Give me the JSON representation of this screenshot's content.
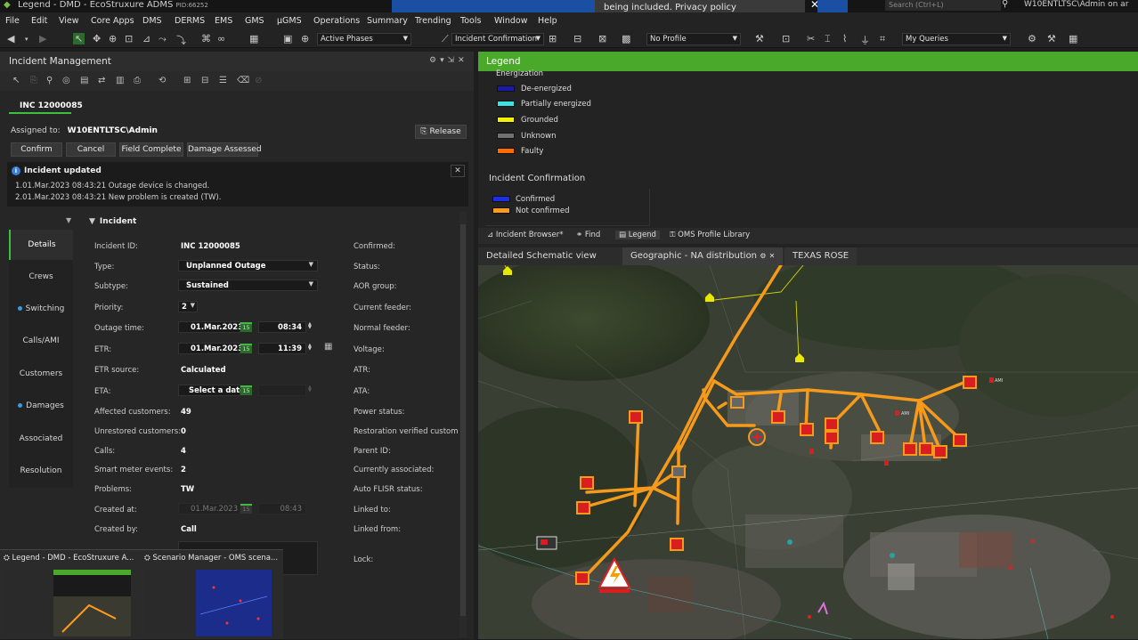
{
  "app": {
    "title": "Legend - DMD - EcoStruxure ADMS",
    "pid": "PID:66252",
    "toast_text": "being included. Privacy policy",
    "search_placeholder": "Search (Ctrl+L)",
    "user": "W10ENTLTSC\\Admin on ar"
  },
  "menu": [
    "File",
    "Edit",
    "View",
    "Core Apps",
    "DMS",
    "DERMS",
    "EMS",
    "GMS",
    "µGMS",
    "Operations",
    "Summary",
    "Trending",
    "Tools",
    "Window",
    "Help"
  ],
  "toolbar": {
    "phases": "Active Phases",
    "confirmation": "Incident Confirmation",
    "profile": "No Profile",
    "queries": "My Queries"
  },
  "incident_panel": {
    "title": "Incident Management",
    "tab": "INC 12000085",
    "assigned_label": "Assigned to:",
    "assigned_value": "W10ENTLTSC\\Admin",
    "release": "Release",
    "buttons": [
      "Confirm",
      "Cancel",
      "Field Complete",
      "Damage Assessed"
    ],
    "notification": {
      "title": "Incident updated",
      "lines": [
        "1.01.Mar.2023 08:43:21  Outage device is changed.",
        "2.01.Mar.2023 08:43:21  New problem is created (TW)."
      ]
    },
    "nav": [
      "Details",
      "Crews",
      "Switching",
      "Calls/AMI",
      "Customers",
      "Damages",
      "Associated",
      "Resolution"
    ],
    "section": "Incident",
    "fields": {
      "incident_id_label": "Incident ID:",
      "incident_id": "INC 12000085",
      "type_label": "Type:",
      "type": "Unplanned Outage",
      "subtype_label": "Subtype:",
      "subtype": "Sustained",
      "priority_label": "Priority:",
      "priority": "2",
      "outage_time_label": "Outage time:",
      "outage_date": "01.Mar.2023",
      "outage_time": "08:34",
      "etr_label": "ETR:",
      "etr_date": "01.Mar.2023",
      "etr_time": "11:39",
      "etr_source_label": "ETR source:",
      "etr_source": "Calculated",
      "eta_label": "ETA:",
      "eta": "Select a date",
      "affected_label": "Affected customers:",
      "affected": "49",
      "unrestored_label": "Unrestored customers:",
      "unrestored": "0",
      "calls_label": "Calls:",
      "calls": "4",
      "smart_label": "Smart meter events:",
      "smart": "2",
      "problems_label": "Problems:",
      "problems": "TW",
      "created_at_label": "Created at:",
      "created_date": "01.Mar.2023",
      "created_time": "08:43",
      "created_by_label": "Created by:",
      "created_by": "Call",
      "cal": "15"
    },
    "right_labels": [
      "Confirmed:",
      "Status:",
      "AOR group:",
      "Current feeder:",
      "Normal feeder:",
      "Voltage:",
      "ATR:",
      "ATA:",
      "Power status:",
      "Restoration verified customers:",
      "Parent ID:",
      "Currently associated:",
      "Auto FLISR status:",
      "Linked to:",
      "Linked from:",
      "Lock:"
    ]
  },
  "taskbar_thumbs": [
    "Legend - DMD - EcoStruxure A...",
    "Scenario Manager - OMS scena..."
  ],
  "legend": {
    "title": "Legend",
    "energization_title": "Energization",
    "energization": [
      {
        "label": "De-energized",
        "color": "#1a1aa8"
      },
      {
        "label": "Partially energized",
        "color": "#3fe0e0"
      },
      {
        "label": "Grounded",
        "color": "#f0f000"
      },
      {
        "label": "Unknown",
        "color": "#707070"
      },
      {
        "label": "Faulty",
        "color": "#ff6a00"
      }
    ],
    "confirmation_title": "Incident Confirmation",
    "confirmation": [
      {
        "label": "Confirmed",
        "color": "#1e2ee8"
      },
      {
        "label": "Not confirmed",
        "color": "#ff9a1e"
      }
    ]
  },
  "right_tabs": [
    "Incident Browser*",
    "Find",
    "Legend",
    "OMS Profile Library"
  ],
  "map_tabs": [
    "Detailed Schematic view",
    "Geographic - NA distribution",
    "TEXAS ROSE"
  ],
  "map_labels": {
    "ami": "AMI"
  },
  "colors": {
    "accent_green": "#4aa82a",
    "line_orange": "#ff9a1e",
    "device_red": "#d81e1e"
  }
}
